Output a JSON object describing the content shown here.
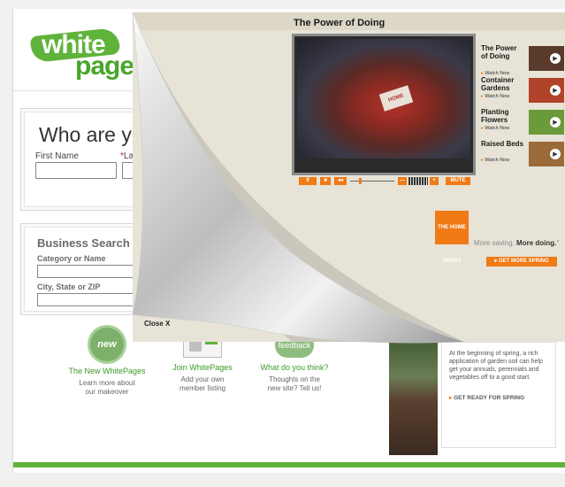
{
  "logo": {
    "line1": "white",
    "line2": "pages",
    "tm": "TM"
  },
  "people_search": {
    "title": "Who are you lo",
    "first_name_label": "First Name",
    "required_mark": "*",
    "last_name_label": "Last"
  },
  "business_search": {
    "title": "Business Search",
    "category_label": "Category or Name",
    "location_label": "City, State or ZIP"
  },
  "features": [
    {
      "icon": "new-badge-icon",
      "badge": "new",
      "title": "The New WhitePages",
      "desc_line1": "Learn more about",
      "desc_line2": "our makeover"
    },
    {
      "icon": "join-member-icon",
      "badge": "w",
      "title": "Join WhitePages",
      "desc_line1": "Add your own",
      "desc_line2": "member listing"
    },
    {
      "icon": "feedback-bubble-icon",
      "badge": "feedback",
      "title": "What do you think?",
      "desc_line1": "Thoughts on the",
      "desc_line2": "new site? Tell us!"
    }
  ],
  "garden_panel": {
    "text": "At the beginning of spring, a rich application of garden soil can help get your annuals, perennials and vegetables off to a good start.",
    "cta_arrow": "▸",
    "cta": "GET READY FOR SPRING"
  },
  "ad": {
    "title": "The Power of Doing",
    "close_label": "Close X",
    "video_apron_text": "HOME DEPOT",
    "controls": {
      "pause": "II",
      "stop": "■",
      "rewind": "◂◂",
      "vol_down": "—",
      "vol_up": "+",
      "mute": "MUTE"
    },
    "playlist": [
      {
        "name": "The Power of Doing",
        "watch_arrow": "▸",
        "watch": "Watch Now",
        "thumb_color": "#5a3a2a"
      },
      {
        "name": "Container Gardens",
        "watch_arrow": "▸",
        "watch": "Watch Now",
        "thumb_color": "#b0432a"
      },
      {
        "name": "Planting Flowers",
        "watch_arrow": "▸",
        "watch": "Watch Now",
        "thumb_color": "#6a9a3a"
      },
      {
        "name": "Raised Beds",
        "watch_arrow": "▸",
        "watch": "Watch Now",
        "thumb_color": "#9a6a3a"
      }
    ],
    "play_glyph": "▶",
    "brand_logo_text": "THE HOME DEPOT",
    "tagline_plain": "More saving. ",
    "tagline_bold": "More doing.",
    "tagline_mark": "°",
    "cta_arrow": "▸",
    "cta": "GET MORE SPRING"
  },
  "colors": {
    "brand_green": "#5fb33b",
    "home_depot_orange": "#f07a16",
    "ad_bg": "#e7e3d6"
  }
}
